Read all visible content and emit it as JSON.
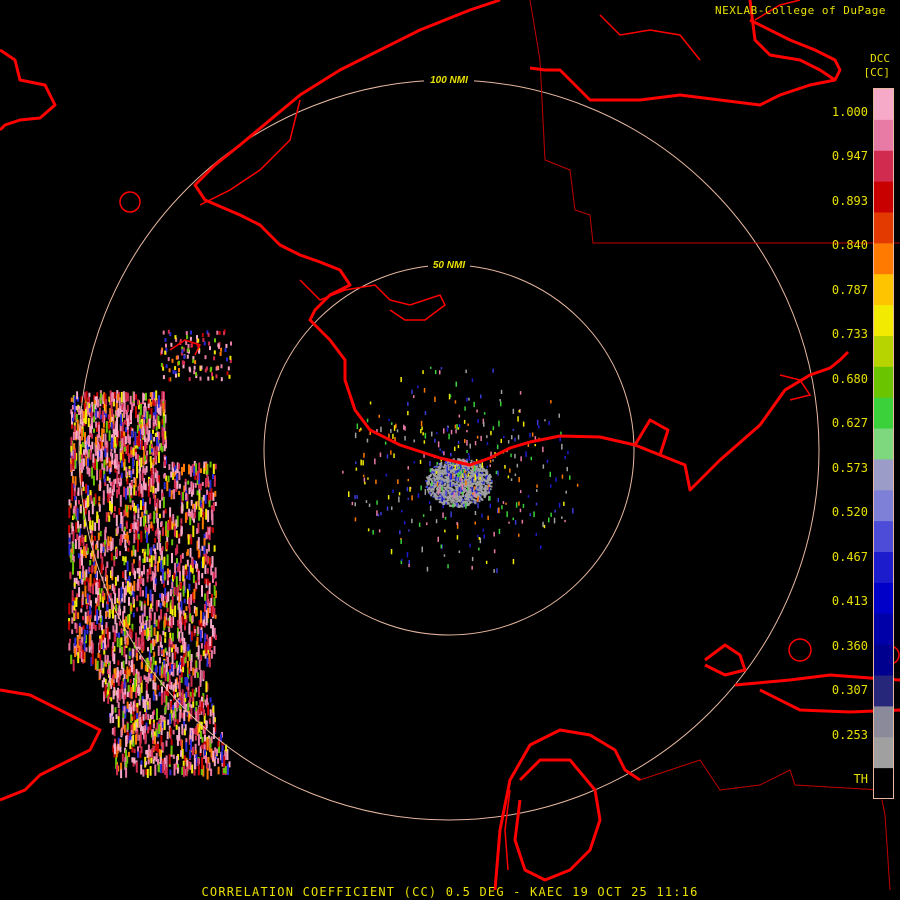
{
  "header": {
    "credit": "NEXLAB-College of DuPage"
  },
  "product": {
    "code": "DCC",
    "unit": "[CC]"
  },
  "caption": "CORRELATION COEFFICIENT (CC) 0.5 DEG - KAEC 19 OCT 25 11:16",
  "range_rings": [
    {
      "label": "50 NMI"
    },
    {
      "label": "100 NMI"
    }
  ],
  "legend": {
    "ticks": [
      "1.000",
      "0.947",
      "0.893",
      "0.840",
      "0.787",
      "0.733",
      "0.680",
      "0.627",
      "0.573",
      "0.520",
      "0.467",
      "0.413",
      "0.360",
      "0.307",
      "0.253",
      "TH"
    ],
    "colors": [
      "#f7a9c8",
      "#e87aa6",
      "#d12b4f",
      "#c80000",
      "#e23a00",
      "#ff7a00",
      "#ffc400",
      "#f2ea00",
      "#b8d400",
      "#6bc400",
      "#3ad13a",
      "#7ed87e",
      "#9c9cc8",
      "#7e80d8",
      "#4c4cd8",
      "#1c1ccc",
      "#0000c8",
      "#0000a8",
      "#00008e",
      "#26267a",
      "#8a8a9a",
      "#a0a0a0",
      "#000000"
    ]
  },
  "colors": {
    "coast": "#ff0000",
    "ring": "#e7b8a0",
    "text": "#e8e000"
  }
}
